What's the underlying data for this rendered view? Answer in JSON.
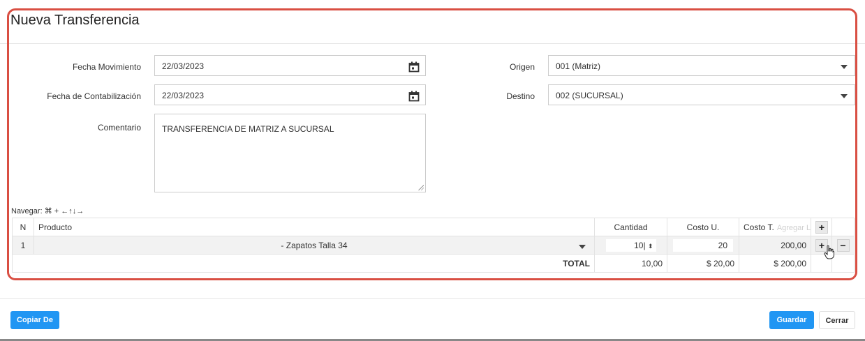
{
  "page": {
    "title": "Nueva Transferencia"
  },
  "form": {
    "fecha_movimiento": {
      "label": "Fecha Movimiento",
      "value": "22/03/2023"
    },
    "fecha_contabilizacion": {
      "label": "Fecha de Contabilización",
      "value": "22/03/2023"
    },
    "comentario": {
      "label": "Comentario",
      "value": "TRANSFERENCIA DE MATRIZ A SUCURSAL"
    },
    "origen": {
      "label": "Origen",
      "value": "001 (Matriz)"
    },
    "destino": {
      "label": "Destino",
      "value": "002 (SUCURSAL)"
    }
  },
  "grid": {
    "nav_hint": "Navegar: ⌘ + ←↑↓→",
    "headers": {
      "n": "N",
      "producto": "Producto",
      "cantidad": "Cantidad",
      "costo_u": "Costo U.",
      "costo_t": "Costo T.",
      "add_line_hint": "Agregar Línea"
    },
    "rows": [
      {
        "n": "1",
        "producto": "- Zapatos Talla 34",
        "cantidad": "10",
        "costo_u": "20",
        "costo_t": "200,00"
      }
    ],
    "totals": {
      "label": "TOTAL",
      "cantidad": "10,00",
      "costo_u": "$ 20,00",
      "costo_t": "$ 200,00"
    }
  },
  "icons": {
    "calendar": "calendar-icon",
    "plus": "+",
    "minus": "−"
  },
  "buttons": {
    "copiar_de": "Copiar De",
    "guardar": "Guardar",
    "cerrar": "Cerrar"
  },
  "colors": {
    "primary": "#2196f3",
    "highlight": "#d94f43"
  }
}
